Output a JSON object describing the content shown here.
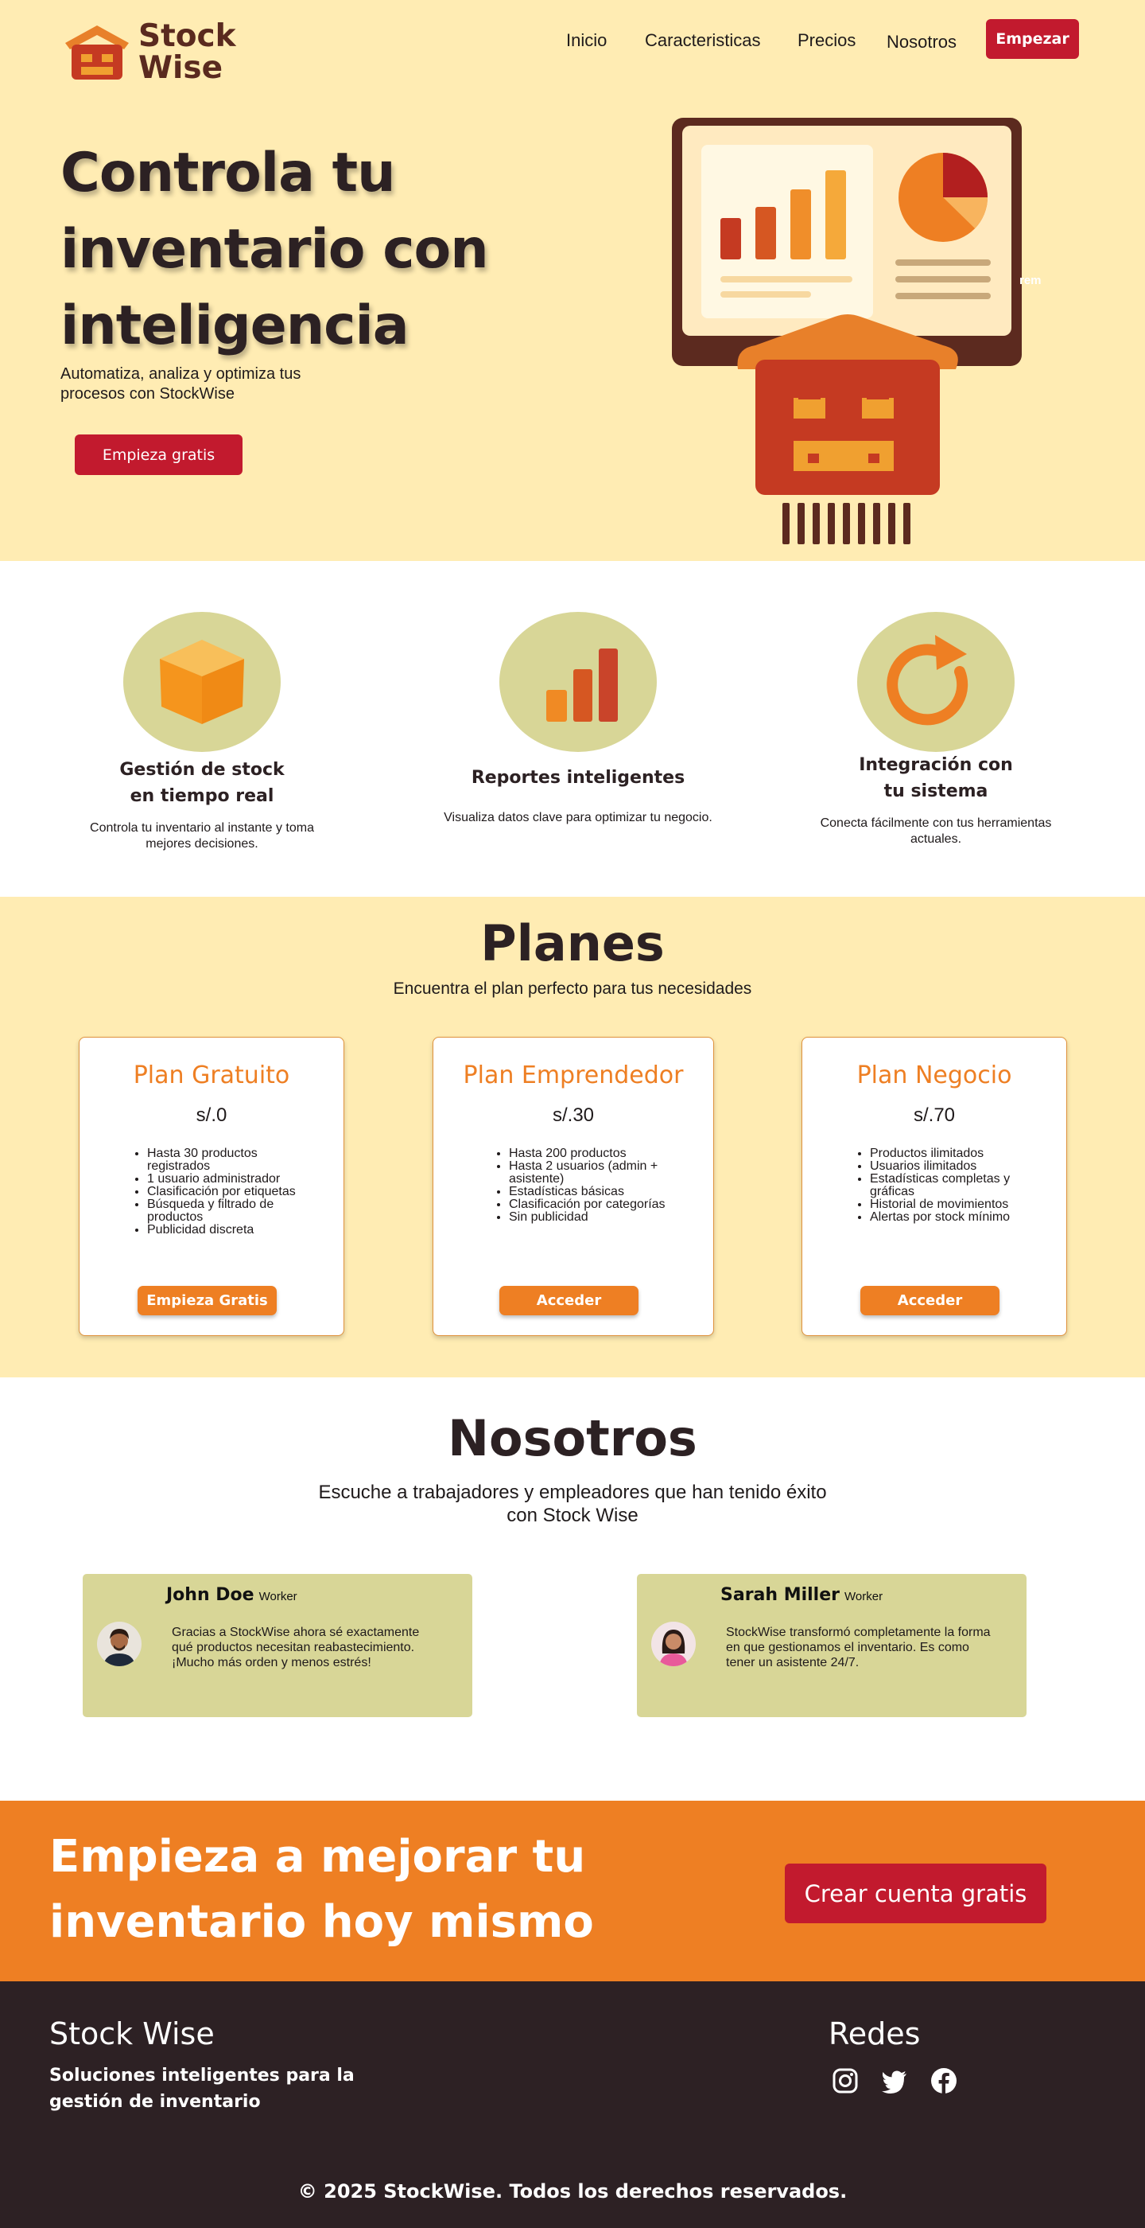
{
  "brand": {
    "line1": "Stock",
    "line2": "Wise"
  },
  "nav": {
    "items": [
      "Inicio",
      "Caracteristicas",
      "Precios",
      "Nosotros"
    ],
    "cta": "Empezar"
  },
  "hero": {
    "title": "Controla tu inventario con inteligencia",
    "subtitle": "Automatiza, analiza y optimiza tus procesos con StockWise",
    "cta": "Empieza gratis",
    "tiny_text": "rem"
  },
  "features": [
    {
      "title_line1": "Gestión de stock",
      "title_line2": "en tiempo real",
      "desc": "Controla tu inventario al instante y toma mejores decisiones.",
      "icon": "box-icon"
    },
    {
      "title_line1": "Reportes inteligentes",
      "title_line2": "",
      "desc": "Visualiza datos clave para optimizar tu negocio.",
      "icon": "bar-chart-icon"
    },
    {
      "title_line1": "Integración con",
      "title_line2": "tu sistema",
      "desc": "Conecta fácilmente con tus herramientas actuales.",
      "icon": "refresh-icon"
    }
  ],
  "plans": {
    "title": "Planes",
    "subtitle": "Encuentra el plan perfecto para tus necesidades",
    "items": [
      {
        "name": "Plan Gratuito",
        "price": "s/.0",
        "button": "Empieza Gratis",
        "features": [
          "Hasta 30 productos registrados",
          "1 usuario administrador",
          "Clasificación por etiquetas",
          "Búsqueda y filtrado de productos",
          "Publicidad discreta"
        ]
      },
      {
        "name": "Plan Emprendedor",
        "price": "s/.30",
        "button": "Acceder",
        "features": [
          "Hasta 200 productos",
          "Hasta 2 usuarios (admin + asistente)",
          "Estadísticas básicas",
          "Clasificación por categorías",
          "Sin publicidad"
        ]
      },
      {
        "name": "Plan Negocio",
        "price": "s/.70",
        "button": "Acceder",
        "features": [
          "Productos ilimitados",
          "Usuarios ilimitados",
          "Estadísticas completas y gráficas",
          "Historial de movimientos",
          "Alertas por stock mínimo"
        ]
      }
    ]
  },
  "about": {
    "title": "Nosotros",
    "subtitle": "Escuche a trabajadores y empleadores que han tenido éxito con Stock Wise",
    "testimonials": [
      {
        "name": "John Doe",
        "role": "Worker",
        "text": "Gracias a StockWise ahora sé exactamente qué productos necesitan reabastecimiento. ¡Mucho más orden y menos estrés!"
      },
      {
        "name": "Sarah Miller",
        "role": "Worker",
        "text": "StockWise transformó completamente la forma en que gestionamos el inventario. Es como tener un asistente 24/7."
      }
    ]
  },
  "cta_band": {
    "title": "Empieza a mejorar tu inventario hoy mismo",
    "button": "Crear cuenta gratis"
  },
  "footer": {
    "brand": "Stock Wise",
    "tagline": "Soluciones inteligentes para la gestión de inventario",
    "socials_title": "Redes",
    "socials": [
      "instagram-icon",
      "twitter-icon",
      "facebook-icon"
    ],
    "copyright": "© 2025 StockWise. Todos los derechos reservados."
  },
  "colors": {
    "cream": "#ffecb3",
    "red": "#c21a2e",
    "orange": "#ee7f23",
    "olive": "#d8d697",
    "dark": "#2d2124",
    "brown": "#5a2a1f"
  }
}
